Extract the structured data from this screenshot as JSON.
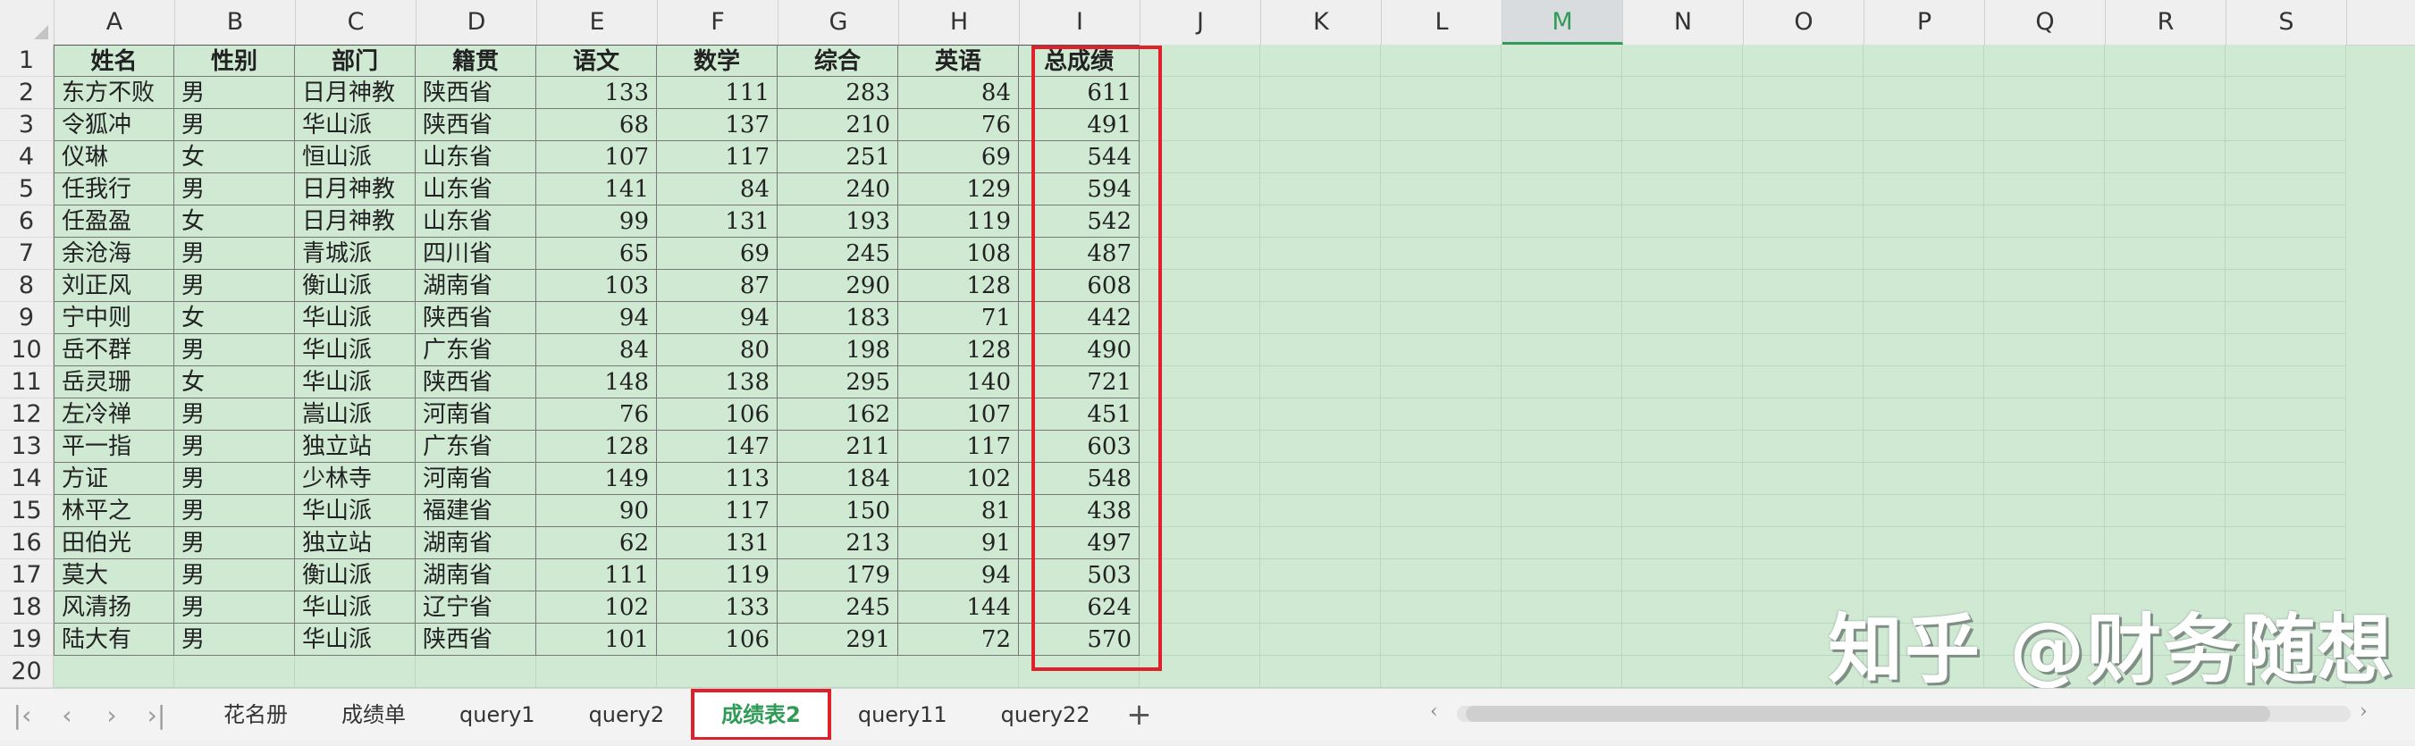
{
  "columns": [
    "A",
    "B",
    "C",
    "D",
    "E",
    "F",
    "G",
    "H",
    "I",
    "J",
    "K",
    "L",
    "M",
    "N",
    "O",
    "P",
    "Q",
    "R",
    "S"
  ],
  "selected_column": "M",
  "header": [
    "姓名",
    "性别",
    "部门",
    "籍贯",
    "语文",
    "数学",
    "综合",
    "英语",
    "总成绩"
  ],
  "rows": [
    [
      "东方不败",
      "男",
      "日月神教",
      "陕西省",
      "133",
      "111",
      "283",
      "84",
      "611"
    ],
    [
      "令狐冲",
      "男",
      "华山派",
      "陕西省",
      "68",
      "137",
      "210",
      "76",
      "491"
    ],
    [
      "仪琳",
      "女",
      "恒山派",
      "山东省",
      "107",
      "117",
      "251",
      "69",
      "544"
    ],
    [
      "任我行",
      "男",
      "日月神教",
      "山东省",
      "141",
      "84",
      "240",
      "129",
      "594"
    ],
    [
      "任盈盈",
      "女",
      "日月神教",
      "山东省",
      "99",
      "131",
      "193",
      "119",
      "542"
    ],
    [
      "余沧海",
      "男",
      "青城派",
      "四川省",
      "65",
      "69",
      "245",
      "108",
      "487"
    ],
    [
      "刘正风",
      "男",
      "衡山派",
      "湖南省",
      "103",
      "87",
      "290",
      "128",
      "608"
    ],
    [
      "宁中则",
      "女",
      "华山派",
      "陕西省",
      "94",
      "94",
      "183",
      "71",
      "442"
    ],
    [
      "岳不群",
      "男",
      "华山派",
      "广东省",
      "84",
      "80",
      "198",
      "128",
      "490"
    ],
    [
      "岳灵珊",
      "女",
      "华山派",
      "陕西省",
      "148",
      "138",
      "295",
      "140",
      "721"
    ],
    [
      "左冷禅",
      "男",
      "嵩山派",
      "河南省",
      "76",
      "106",
      "162",
      "107",
      "451"
    ],
    [
      "平一指",
      "男",
      "独立站",
      "广东省",
      "128",
      "147",
      "211",
      "117",
      "603"
    ],
    [
      "方证",
      "男",
      "少林寺",
      "河南省",
      "149",
      "113",
      "184",
      "102",
      "548"
    ],
    [
      "林平之",
      "男",
      "华山派",
      "福建省",
      "90",
      "117",
      "150",
      "81",
      "438"
    ],
    [
      "田伯光",
      "男",
      "独立站",
      "湖南省",
      "62",
      "131",
      "213",
      "91",
      "497"
    ],
    [
      "莫大",
      "男",
      "衡山派",
      "湖南省",
      "111",
      "119",
      "179",
      "94",
      "503"
    ],
    [
      "风清扬",
      "男",
      "华山派",
      "辽宁省",
      "102",
      "133",
      "245",
      "144",
      "624"
    ],
    [
      "陆大有",
      "男",
      "华山派",
      "陕西省",
      "101",
      "106",
      "291",
      "72",
      "570"
    ]
  ],
  "row_numbers": [
    "1",
    "2",
    "3",
    "4",
    "5",
    "6",
    "7",
    "8",
    "9",
    "10",
    "11",
    "12",
    "13",
    "14",
    "15",
    "16",
    "17",
    "18",
    "19",
    "20"
  ],
  "tabs": [
    "花名册",
    "成绩单",
    "query1",
    "query2",
    "成绩表2",
    "query11",
    "query22"
  ],
  "active_tab": "成绩表2",
  "watermark": "知乎 @财务随想",
  "colors": {
    "cell_bg": "#cfe9d3",
    "accent": "#2f9b57",
    "highlight": "#e0202a"
  }
}
